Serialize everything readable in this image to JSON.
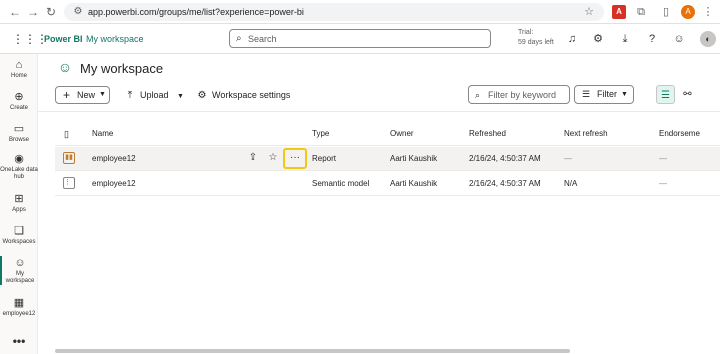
{
  "browser": {
    "url": "app.powerbi.com/groups/me/list?experience=power-bi",
    "profile_initial": "A",
    "icons": [
      "back-arrow",
      "forward-arrow",
      "reload",
      "site-info",
      "bookmark-star",
      "pdf-extension",
      "extensions-puzzle",
      "side-panel",
      "profile",
      "more-vertical"
    ]
  },
  "header": {
    "app_name": "Power BI",
    "workspace_crumb": "My workspace",
    "search_placeholder": "Search",
    "trial_line1": "Trial:",
    "trial_line2": "59 days left"
  },
  "leftnav": {
    "items": [
      {
        "label": "Home",
        "icon": "home-icon"
      },
      {
        "label": "Create",
        "icon": "plus-circle-icon"
      },
      {
        "label": "Browse",
        "icon": "folder-icon"
      },
      {
        "label": "OneLake data hub",
        "icon": "onelake-icon"
      },
      {
        "label": "Apps",
        "icon": "apps-icon"
      },
      {
        "label": "Workspaces",
        "icon": "workspaces-icon"
      },
      {
        "label": "My workspace",
        "icon": "person-icon",
        "active": true
      },
      {
        "label": "employee12",
        "icon": "model-icon"
      }
    ],
    "more": "•••"
  },
  "workspace": {
    "title": "My workspace"
  },
  "toolbar": {
    "new_label": "New",
    "upload_label": "Upload",
    "settings_label": "Workspace settings",
    "filter_placeholder": "Filter by keyword",
    "filter_label": "Filter"
  },
  "table": {
    "columns": [
      "Name",
      "Type",
      "Owner",
      "Refreshed",
      "Next refresh",
      "Endorseme"
    ],
    "rows": [
      {
        "name": "employee12",
        "type": "Report",
        "owner": "Aarti Kaushik",
        "refreshed": "2/16/24, 4:50:37 AM",
        "next_refresh": "—",
        "endorsement": "—",
        "icon": "report-icon"
      },
      {
        "name": "employee12",
        "type": "Semantic model",
        "owner": "Aarti Kaushik",
        "refreshed": "2/16/24, 4:50:37 AM",
        "next_refresh": "N/A",
        "endorsement": "—",
        "icon": "semantic-model-icon"
      }
    ]
  },
  "colors": {
    "accent": "#117865",
    "highlight": "#f2c811"
  }
}
